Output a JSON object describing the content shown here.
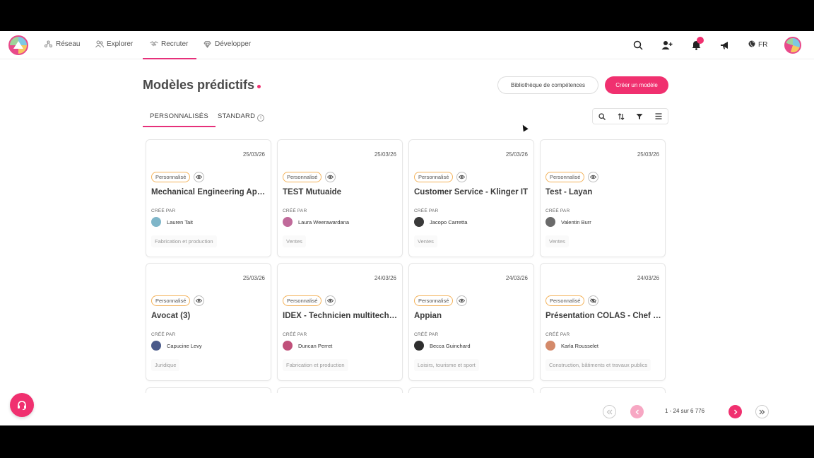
{
  "nav": {
    "items": [
      {
        "label": "Réseau",
        "icon": "network-icon"
      },
      {
        "label": "Explorer",
        "icon": "people-icon"
      },
      {
        "label": "Recruter",
        "icon": "handshake-icon"
      },
      {
        "label": "Développer",
        "icon": "diamond-icon"
      }
    ],
    "active": "Recruter",
    "language": "FR"
  },
  "page": {
    "title": "Modèles prédictifs",
    "skills_library_label": "Bibliothèque de compétences",
    "create_model_label": "Créer un modèle"
  },
  "tabs": [
    {
      "label": "PERSONNALISÉS",
      "active": true
    },
    {
      "label": "STANDARD",
      "active": false
    }
  ],
  "cards": [
    {
      "date": "25/03/26",
      "badge": "Personnalisé",
      "name": "Mechanical Engineering Applications",
      "created_by_label": "CRÉÉ PAR",
      "author": "Lauren Tait",
      "tag": "Fabrication et production",
      "avatar_color": "#7fb6c9",
      "visible": true
    },
    {
      "date": "25/03/26",
      "badge": "Personnalisé",
      "name": "TEST Mutuaide",
      "created_by_label": "CRÉÉ PAR",
      "author": "Laura Weerawardana",
      "tag": "Ventes",
      "avatar_color": "#c06a9a",
      "visible": true
    },
    {
      "date": "25/03/26",
      "badge": "Personnalisé",
      "name": "Customer Service - Klinger IT",
      "created_by_label": "CRÉÉ PAR",
      "author": "Jacopo Carretta",
      "tag": "Ventes",
      "avatar_color": "#3a3a3a",
      "visible": true
    },
    {
      "date": "25/03/26",
      "badge": "Personnalisé",
      "name": "Test - Layan",
      "created_by_label": "CRÉÉ PAR",
      "author": "Valentin Burr",
      "tag": "Ventes",
      "avatar_color": "#6a6a6a",
      "visible": true
    },
    {
      "date": "25/03/26",
      "badge": "Personnalisé",
      "name": "Avocat (3)",
      "created_by_label": "CRÉÉ PAR",
      "author": "Capucine Levy",
      "tag": "Juridique",
      "avatar_color": "#4a5a8a",
      "visible": true
    },
    {
      "date": "24/03/26",
      "badge": "Personnalisé",
      "name": "IDEX - Technicien multitechnique",
      "created_by_label": "CRÉÉ PAR",
      "author": "Duncan Perret",
      "tag": "Fabrication et production",
      "avatar_color": "#c0507a",
      "visible": true
    },
    {
      "date": "24/03/26",
      "badge": "Personnalisé",
      "name": "Appian",
      "created_by_label": "CRÉÉ PAR",
      "author": "Becca Guinchard",
      "tag": "Loisirs, tourisme et sport",
      "avatar_color": "#2e2e2e",
      "visible": true
    },
    {
      "date": "24/03/26",
      "badge": "Personnalisé",
      "name": "Présentation COLAS - Chef de chantier",
      "created_by_label": "CRÉÉ PAR",
      "author": "Karla Rousselet",
      "tag": "Construction, bâtiments et travaux publics",
      "avatar_color": "#d48a6a",
      "visible": false
    }
  ],
  "pagination": {
    "range": "1 - 24 sur 6 776"
  },
  "colors": {
    "accent": "#f0306f",
    "badge_border": "#f3b25a"
  }
}
